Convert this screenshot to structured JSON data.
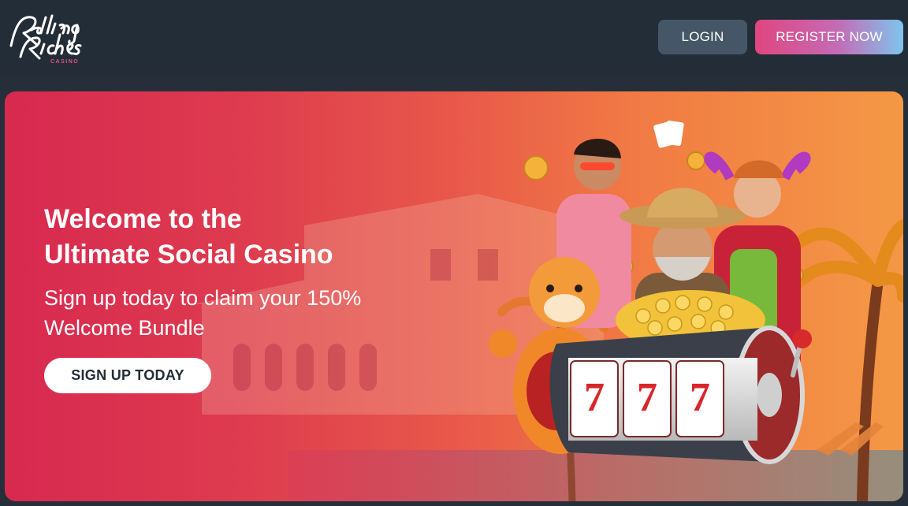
{
  "brand": {
    "logo_text": "Rolling Riches",
    "logo_subtext": "CASINO"
  },
  "header": {
    "login_label": "LOGIN",
    "register_label": "REGISTER NOW"
  },
  "hero": {
    "title_line1": "Welcome to the",
    "title_line2": "Ultimate Social Casino",
    "subtitle_line1": "Sign up today to claim your 150%",
    "subtitle_line2": "Welcome Bundle",
    "cta_label": "SIGN UP TODAY"
  },
  "slot_reels": [
    "7",
    "7",
    "7"
  ],
  "colors": {
    "header_bg": "#232d37",
    "login_bg": "#455766",
    "register_gradient_start": "#e0467f",
    "register_gradient_end": "#7ec5ec",
    "hero_gradient_start": "#d8294f",
    "hero_gradient_end": "#f49845"
  }
}
